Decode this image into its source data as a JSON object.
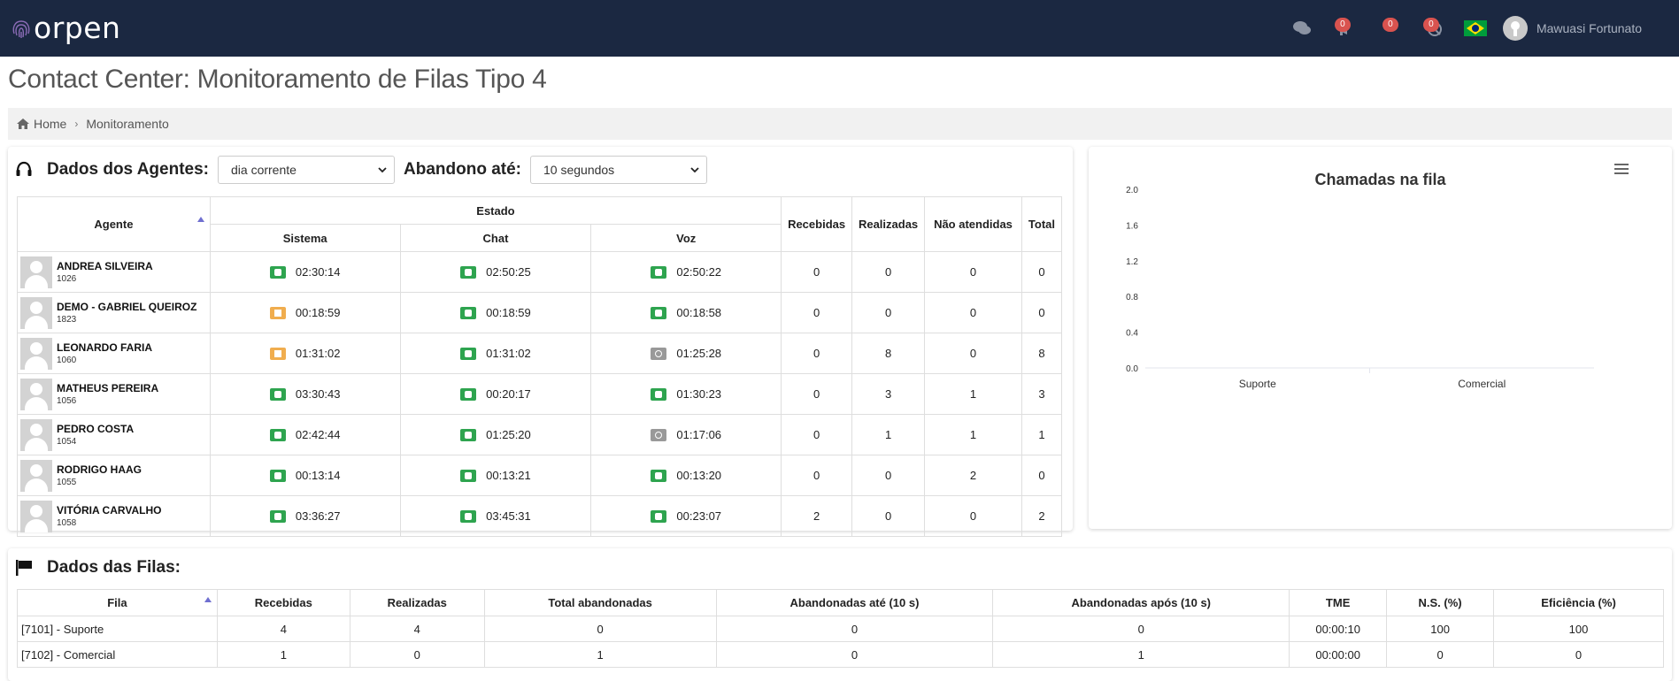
{
  "app": {
    "brand": "orpen",
    "user_name": "Mawuasi Fortunato",
    "notifications": {
      "alerts": "0",
      "messages": "0",
      "calls": "0"
    }
  },
  "page": {
    "title": "Contact Center: Monitoramento de Filas Tipo 4",
    "breadcrumb": {
      "home": "Home",
      "current": "Monitoramento"
    }
  },
  "agents_panel": {
    "title": "Dados dos Agentes:",
    "period_select": "dia corrente",
    "abandon_label": "Abandono até:",
    "abandon_select": "10 segundos",
    "headers": {
      "agente": "Agente",
      "estado": "Estado",
      "sistema": "Sistema",
      "chat": "Chat",
      "voz": "Voz",
      "recebidas": "Recebidas",
      "realizadas": "Realizadas",
      "nao_atendidas": "Não atendidas",
      "total": "Total"
    },
    "rows": [
      {
        "name": "ANDREA SILVEIRA",
        "ext": "1026",
        "sistema": "02:30:14",
        "sistema_state": "green",
        "chat": "02:50:25",
        "chat_state": "green",
        "voz": "02:50:22",
        "voz_state": "green",
        "recebidas": "0",
        "realizadas": "0",
        "nao_atendidas": "0",
        "total": "0"
      },
      {
        "name": "DEMO - GABRIEL QUEIROZ",
        "ext": "1823",
        "sistema": "00:18:59",
        "sistema_state": "orange",
        "chat": "00:18:59",
        "chat_state": "green",
        "voz": "00:18:58",
        "voz_state": "green",
        "recebidas": "0",
        "realizadas": "0",
        "nao_atendidas": "0",
        "total": "0"
      },
      {
        "name": "LEONARDO FARIA",
        "ext": "1060",
        "sistema": "01:31:02",
        "sistema_state": "orange",
        "chat": "01:31:02",
        "chat_state": "green",
        "voz": "01:25:28",
        "voz_state": "gray",
        "recebidas": "0",
        "realizadas": "8",
        "nao_atendidas": "0",
        "total": "8"
      },
      {
        "name": "MATHEUS PEREIRA",
        "ext": "1056",
        "sistema": "03:30:43",
        "sistema_state": "green",
        "chat": "00:20:17",
        "chat_state": "green",
        "voz": "01:30:23",
        "voz_state": "green",
        "recebidas": "0",
        "realizadas": "3",
        "nao_atendidas": "1",
        "total": "3"
      },
      {
        "name": "PEDRO COSTA",
        "ext": "1054",
        "sistema": "02:42:44",
        "sistema_state": "green",
        "chat": "01:25:20",
        "chat_state": "green",
        "voz": "01:17:06",
        "voz_state": "gray",
        "recebidas": "0",
        "realizadas": "1",
        "nao_atendidas": "1",
        "total": "1"
      },
      {
        "name": "RODRIGO HAAG",
        "ext": "1055",
        "sistema": "00:13:14",
        "sistema_state": "green",
        "chat": "00:13:21",
        "chat_state": "green",
        "voz": "00:13:20",
        "voz_state": "green",
        "recebidas": "0",
        "realizadas": "0",
        "nao_atendidas": "2",
        "total": "0"
      },
      {
        "name": "VITÓRIA CARVALHO",
        "ext": "1058",
        "sistema": "03:36:27",
        "sistema_state": "green",
        "chat": "03:45:31",
        "chat_state": "green",
        "voz": "00:23:07",
        "voz_state": "green",
        "recebidas": "2",
        "realizadas": "0",
        "nao_atendidas": "0",
        "total": "2"
      }
    ]
  },
  "chart_data": {
    "type": "bar",
    "title": "Chamadas na fila",
    "categories": [
      "Suporte",
      "Comercial"
    ],
    "values": [
      0,
      0
    ],
    "ylim": [
      0,
      2.0
    ],
    "yticks": [
      "0.0",
      "0.4",
      "0.8",
      "1.2",
      "1.6",
      "2.0"
    ],
    "xlabel": "",
    "ylabel": "",
    "grid": false
  },
  "queues_panel": {
    "title": "Dados das Filas:",
    "headers": {
      "fila": "Fila",
      "recebidas": "Recebidas",
      "realizadas": "Realizadas",
      "total_abandonadas": "Total abandonadas",
      "abandonadas_ate": "Abandonadas até (10 s)",
      "abandonadas_apos": "Abandonadas após (10 s)",
      "tme": "TME",
      "ns": "N.S. (%)",
      "eficiencia": "Eficiência (%)"
    },
    "rows": [
      {
        "fila": "[7101] - Suporte",
        "recebidas": "4",
        "realizadas": "4",
        "total_abandonadas": "0",
        "abandonadas_ate": "0",
        "abandonadas_apos": "0",
        "tme": "00:00:10",
        "ns": "100",
        "eficiencia": "100"
      },
      {
        "fila": "[7102] - Comercial",
        "recebidas": "1",
        "realizadas": "0",
        "total_abandonadas": "1",
        "abandonadas_ate": "0",
        "abandonadas_apos": "1",
        "tme": "00:00:00",
        "ns": "0",
        "eficiencia": "0"
      }
    ]
  },
  "colors": {
    "topbar": "#1b2841",
    "state_green": "#2ea44f",
    "state_orange": "#f0ad4e",
    "state_gray": "#999999",
    "badge": "#d9534f"
  }
}
